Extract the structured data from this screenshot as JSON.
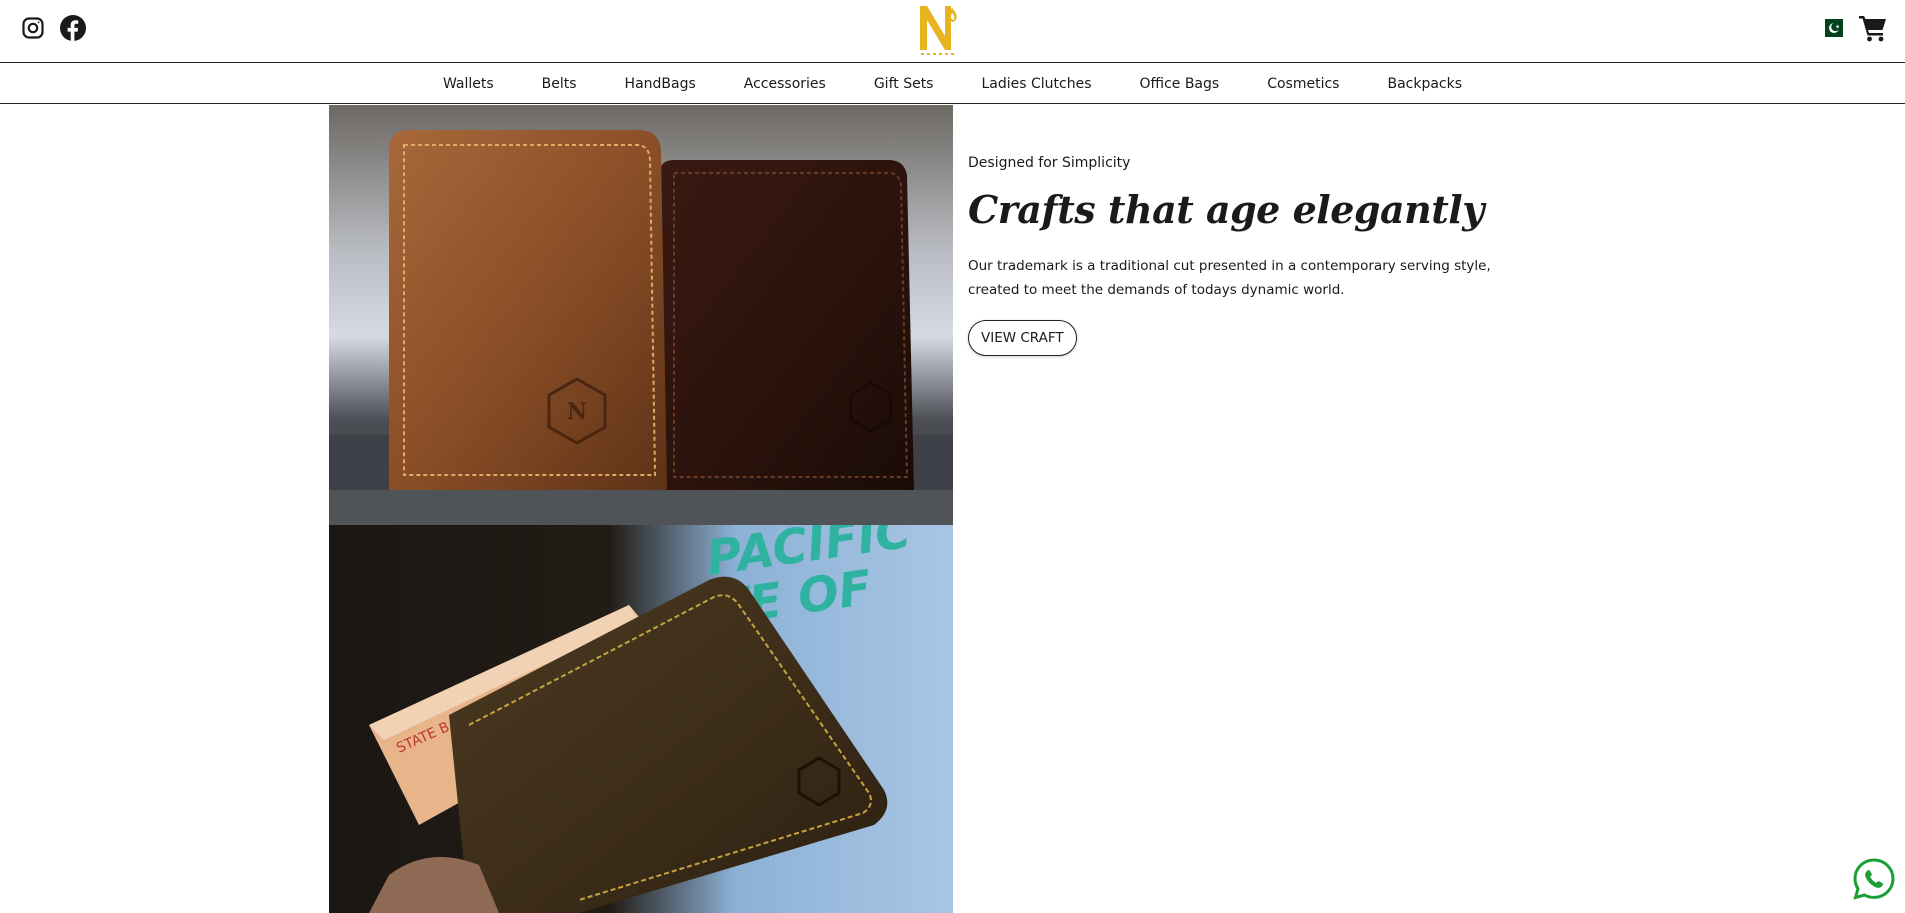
{
  "header": {
    "social_icons": [
      "instagram-icon",
      "facebook-icon"
    ],
    "logo_icon": "brand-logo",
    "flag_icon": "pakistan-flag-icon",
    "cart_icon": "cart-icon"
  },
  "nav": {
    "items": [
      "Wallets",
      "Belts",
      "HandBags",
      "Accessories",
      "Gift Sets",
      "Ladies Clutches",
      "Office Bags",
      "Cosmetics",
      "Backpacks"
    ]
  },
  "hero": {
    "eyebrow": "Designed for Simplicity",
    "headline": "Crafts that age elegantly",
    "description": "Our trademark is a traditional cut presented in a contemporary serving style, created to meet the demands of todays dynamic world.",
    "cta_label": "VIEW CRAFT"
  },
  "images": {
    "top_alt": "Two leather wallets standing on a glass surface",
    "bottom_alt": "Hand holding a dark leather wallet with banknotes"
  },
  "floating": {
    "whatsapp_icon": "whatsapp-icon"
  },
  "colors": {
    "brand_gold": "#e8b321",
    "text": "#1a1a1a",
    "whatsapp_green": "#1a9e35",
    "flag_green": "#01411c"
  }
}
